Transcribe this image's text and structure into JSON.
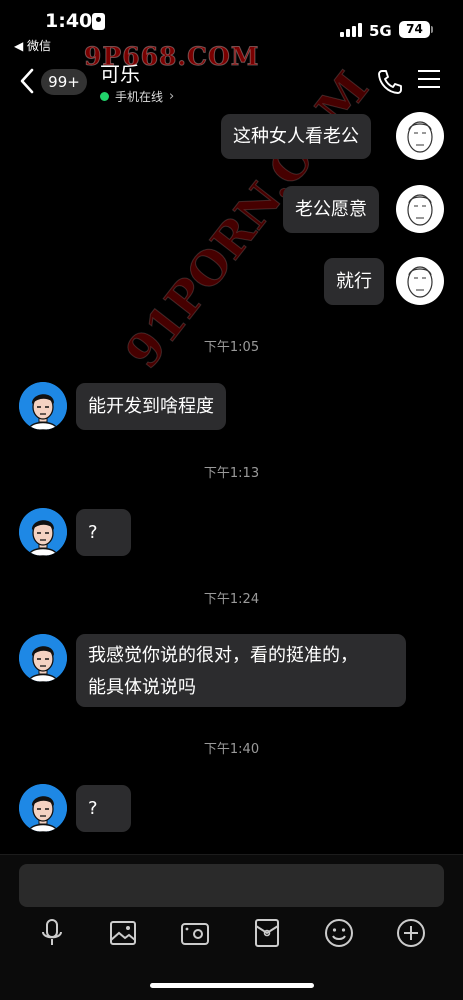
{
  "status_bar": {
    "time": "1:40",
    "back_app": "◀ 微信",
    "network": "5G",
    "battery": "74"
  },
  "nav": {
    "unread_count": "99+",
    "contact_name": "可乐",
    "online_status": "手机在线",
    "chevron": "›"
  },
  "watermarks": {
    "top": "9P668.COM",
    "diagonal": "91PORN.COM"
  },
  "messages": {
    "m1": "这种女人看老公",
    "m2": "老公愿意",
    "m3": "就行",
    "t1": "下午1:05",
    "m4": "能开发到啥程度",
    "t2": "下午1:13",
    "m5": "?",
    "t3": "下午1:24",
    "m6_line1": "我感觉你说的很对，看的挺准的，",
    "m6_line2": "能具体说说吗",
    "t4": "下午1:40",
    "m7": "?"
  },
  "composer": {
    "placeholder": ""
  },
  "icons": [
    "mic-icon",
    "image-icon",
    "camera-icon",
    "red-packet-icon",
    "emoji-icon",
    "plus-icon"
  ],
  "colors": {
    "background": "#000000",
    "bubble": "#2c2c2e",
    "online": "#21d36b",
    "avatar_blue": "#1e88e5"
  }
}
